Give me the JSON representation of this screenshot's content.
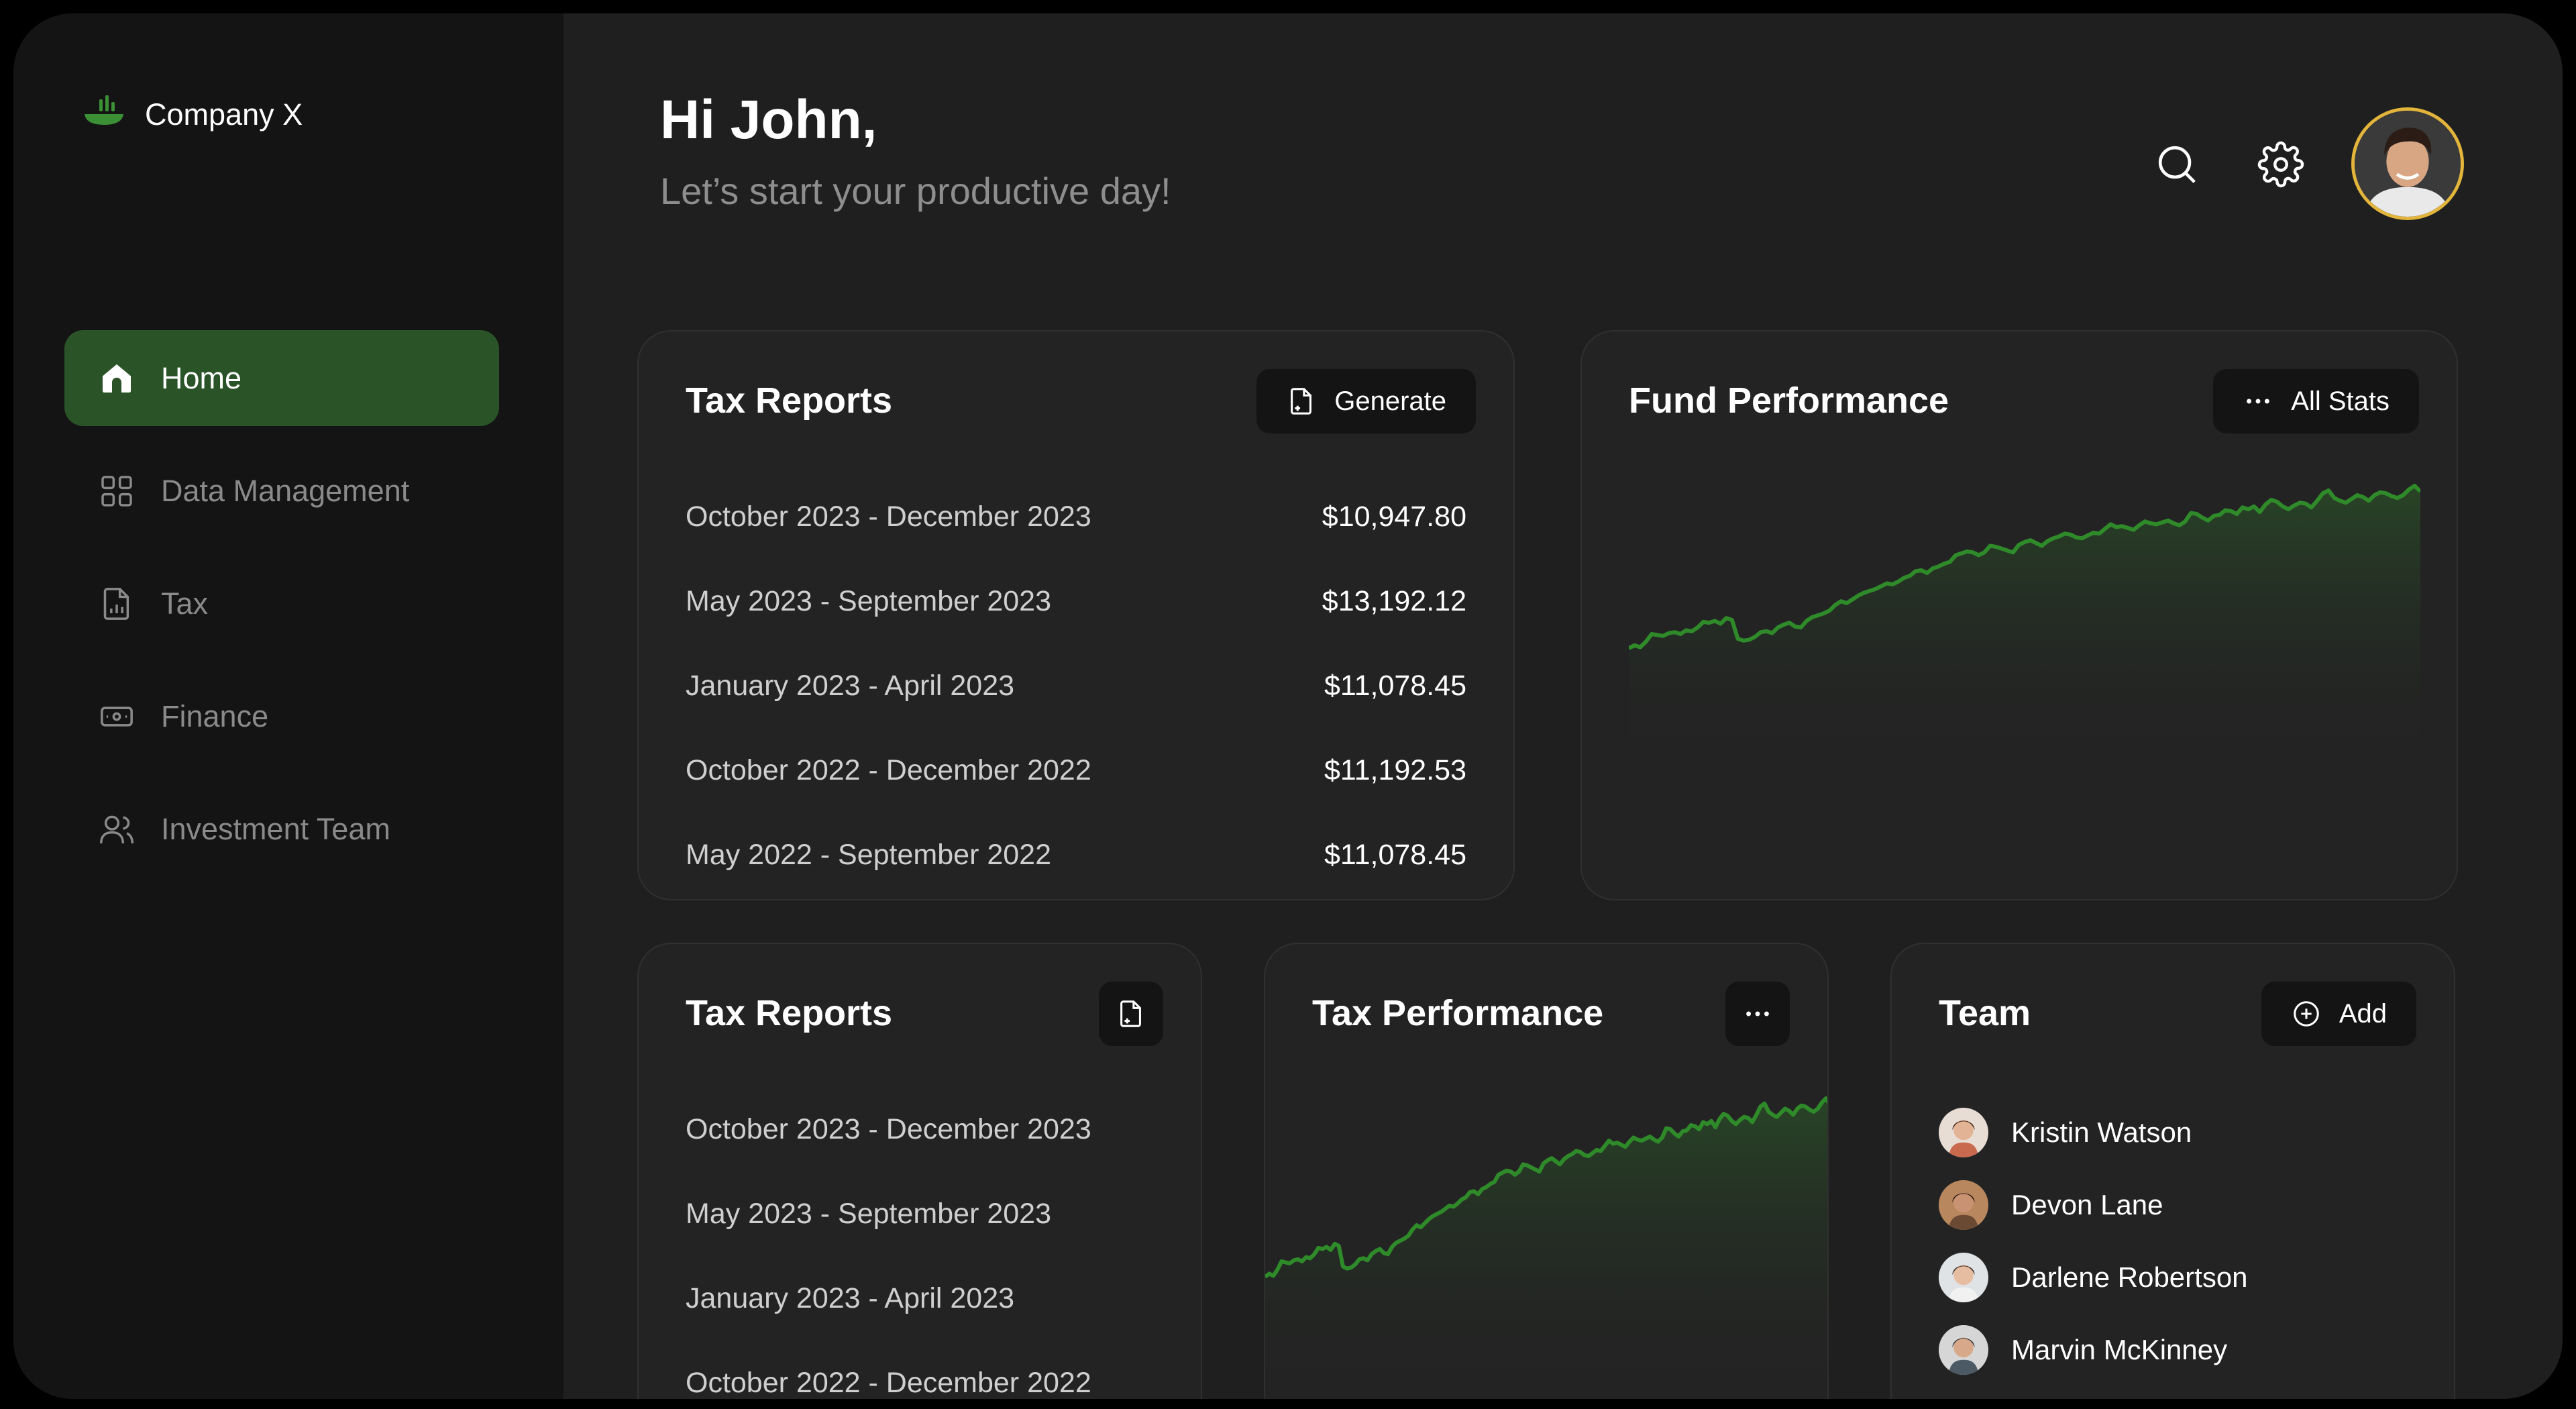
{
  "app": {
    "name": "Company X"
  },
  "sidebar": {
    "items": [
      {
        "label": "Home",
        "icon": "home-icon",
        "active": true
      },
      {
        "label": "Data Management",
        "icon": "grid-icon"
      },
      {
        "label": "Tax",
        "icon": "document-chart-icon"
      },
      {
        "label": "Finance",
        "icon": "banknote-icon"
      },
      {
        "label": "Investment Team",
        "icon": "users-icon"
      }
    ]
  },
  "header": {
    "greeting": "Hi John,",
    "subtitle": "Let’s start your productive day!"
  },
  "tax_reports": {
    "title": "Tax Reports",
    "generate_label": "Generate",
    "rows": [
      {
        "period": "October 2023 - December 2023",
        "amount": "$10,947.80"
      },
      {
        "period": "May 2023 - September 2023",
        "amount": "$13,192.12"
      },
      {
        "period": "January 2023 - April 2023",
        "amount": "$11,078.45"
      },
      {
        "period": "October 2022 - December 2022",
        "amount": "$11,192.53"
      },
      {
        "period": "May 2022 - September 2022",
        "amount": "$11,078.45"
      }
    ]
  },
  "fund_performance": {
    "title": "Fund Performance",
    "all_stats_label": "All Stats"
  },
  "tax_reports_small": {
    "title": "Tax Reports",
    "rows": [
      {
        "period": "October 2023 - December 2023"
      },
      {
        "period": "May 2023 - September 2023"
      },
      {
        "period": "January 2023 - April 2023"
      },
      {
        "period": "October 2022 - December 2022"
      }
    ]
  },
  "tax_performance": {
    "title": "Tax Performance"
  },
  "team": {
    "title": "Team",
    "add_label": "Add",
    "members": [
      {
        "name": "Kristin Watson"
      },
      {
        "name": "Devon Lane"
      },
      {
        "name": "Darlene Robertson"
      },
      {
        "name": "Marvin McKinney"
      }
    ]
  },
  "chart_data": [
    {
      "type": "area",
      "title": "Fund Performance",
      "xlabel": "",
      "ylabel": "",
      "grid": false,
      "values": [
        5,
        8,
        6,
        12,
        20,
        19,
        18,
        21,
        22,
        20,
        24,
        23,
        27,
        33,
        32,
        34,
        31,
        37,
        35,
        15,
        13,
        14,
        17,
        22,
        23,
        21,
        27,
        30,
        32,
        28,
        27,
        34,
        38,
        40,
        42,
        45,
        51,
        55,
        53,
        57,
        61,
        64,
        66,
        68,
        71,
        74,
        73,
        76,
        80,
        82,
        87,
        88,
        85,
        90,
        92,
        95,
        97,
        104,
        106,
        108,
        107,
        104,
        107,
        114,
        113,
        111,
        109,
        107,
        115,
        118,
        120,
        117,
        114,
        119,
        122,
        124,
        127,
        126,
        123,
        122,
        125,
        128,
        127,
        132,
        137,
        134,
        135,
        133,
        131,
        136,
        140,
        138,
        137,
        139,
        141,
        138,
        136,
        140,
        149,
        148,
        144,
        141,
        146,
        147,
        152,
        151,
        148,
        155,
        153,
        156,
        150,
        158,
        163,
        161,
        156,
        153,
        157,
        160,
        159,
        155,
        162,
        170,
        173,
        165,
        162,
        160,
        164,
        168,
        166,
        162,
        168,
        171,
        170,
        167,
        165,
        168,
        174,
        178,
        172
      ]
    },
    {
      "type": "area",
      "title": "Tax Performance",
      "xlabel": "",
      "ylabel": "",
      "grid": false,
      "values": [
        5,
        8,
        6,
        12,
        20,
        19,
        18,
        21,
        22,
        20,
        24,
        23,
        27,
        33,
        32,
        34,
        31,
        37,
        35,
        15,
        13,
        14,
        17,
        22,
        23,
        21,
        27,
        30,
        32,
        28,
        27,
        34,
        38,
        40,
        42,
        45,
        51,
        55,
        53,
        57,
        61,
        64,
        66,
        68,
        71,
        74,
        73,
        76,
        80,
        82,
        87,
        88,
        85,
        90,
        92,
        95,
        97,
        104,
        106,
        108,
        107,
        104,
        107,
        114,
        113,
        111,
        109,
        107,
        115,
        118,
        120,
        117,
        114,
        119,
        122,
        124,
        127,
        126,
        123,
        122,
        125,
        128,
        127,
        132,
        137,
        134,
        135,
        133,
        131,
        136,
        140,
        138,
        137,
        139,
        141,
        138,
        136,
        140,
        149,
        148,
        144,
        141,
        146,
        147,
        152,
        151,
        148,
        155,
        153,
        156,
        150,
        158,
        163,
        161,
        156,
        153,
        157,
        160,
        159,
        155,
        162,
        170,
        173,
        165,
        162,
        160,
        164,
        168,
        166,
        162,
        168,
        171,
        170,
        167,
        165,
        168,
        174,
        178,
        172
      ]
    }
  ]
}
